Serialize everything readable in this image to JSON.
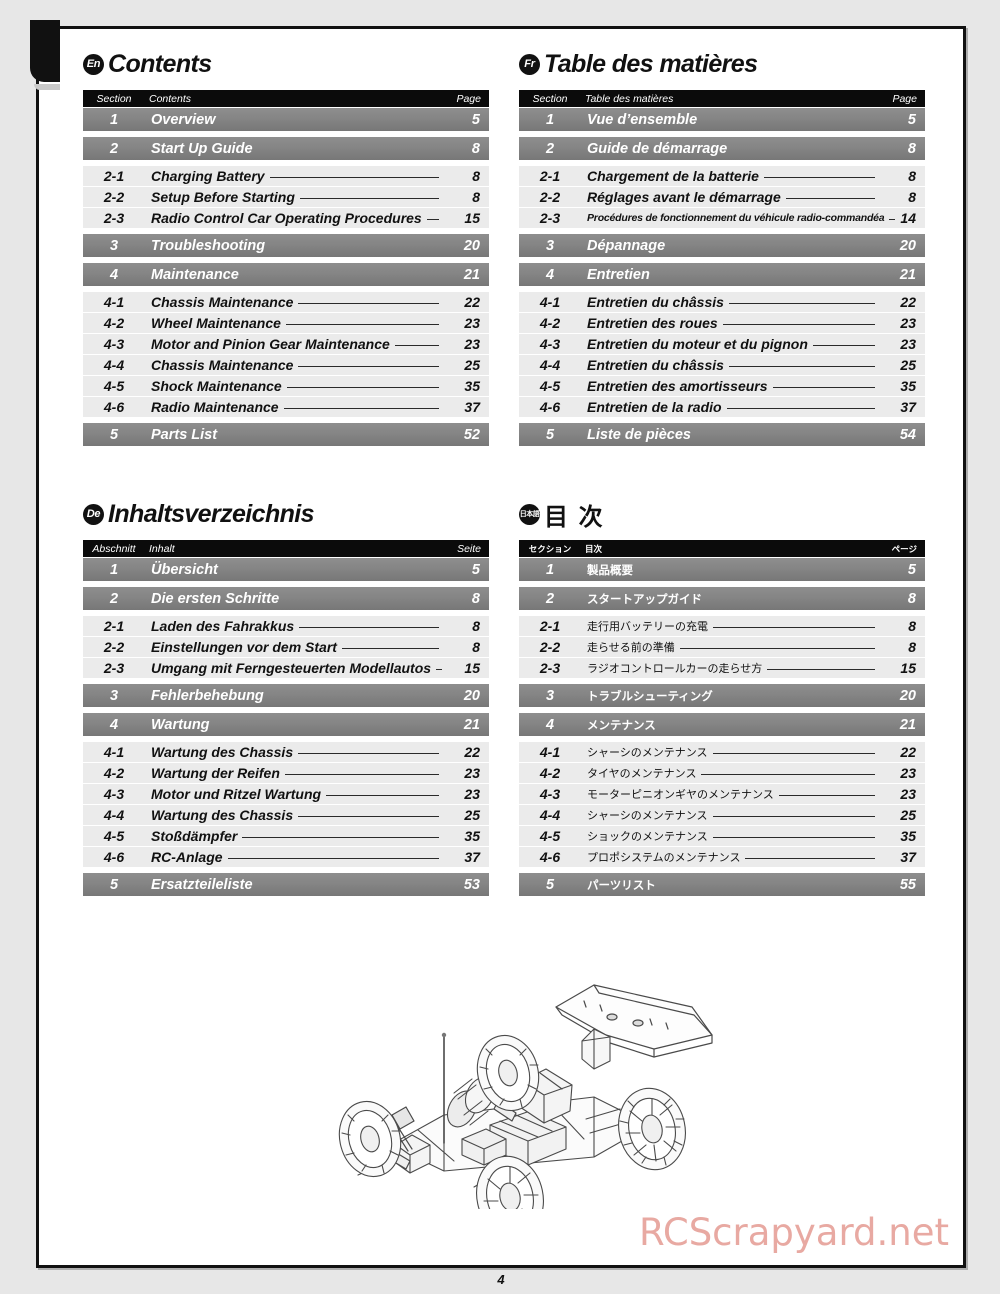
{
  "page": {
    "number": "4",
    "watermark": "RCScrapyard.net"
  },
  "toc_sections": [
    {
      "id": "en",
      "badge": "En",
      "title": "Contents",
      "headers": {
        "section": "Section",
        "name": "Contents",
        "page": "Page"
      },
      "rows": [
        {
          "type": "major",
          "sec": "1",
          "name": "Overview",
          "page": "5"
        },
        {
          "type": "major",
          "sec": "2",
          "name": "Start Up Guide",
          "page": "8"
        },
        {
          "type": "sub",
          "sec": "2-1",
          "name": "Charging Battery",
          "page": "8"
        },
        {
          "type": "sub",
          "sec": "2-2",
          "name": "Setup Before Starting",
          "page": "8"
        },
        {
          "type": "sub",
          "sec": "2-3",
          "name": "Radio Control Car Operating Procedures",
          "page": "15"
        },
        {
          "type": "major",
          "sec": "3",
          "name": "Troubleshooting",
          "page": "20"
        },
        {
          "type": "major",
          "sec": "4",
          "name": "Maintenance",
          "page": "21"
        },
        {
          "type": "sub",
          "sec": "4-1",
          "name": "Chassis Maintenance",
          "page": "22"
        },
        {
          "type": "sub",
          "sec": "4-2",
          "name": "Wheel Maintenance",
          "page": "23"
        },
        {
          "type": "sub",
          "sec": "4-3",
          "name": "Motor and Pinion Gear Maintenance",
          "page": "23"
        },
        {
          "type": "sub",
          "sec": "4-4",
          "name": "Chassis Maintenance",
          "page": "25"
        },
        {
          "type": "sub",
          "sec": "4-5",
          "name": "Shock Maintenance",
          "page": "35"
        },
        {
          "type": "sub",
          "sec": "4-6",
          "name": "Radio Maintenance",
          "page": "37"
        },
        {
          "type": "major",
          "sec": "5",
          "name": "Parts List",
          "page": "52"
        }
      ]
    },
    {
      "id": "fr",
      "badge": "Fr",
      "title": "Table des matières",
      "headers": {
        "section": "Section",
        "name": "Table des matières",
        "page": "Page"
      },
      "rows": [
        {
          "type": "major",
          "sec": "1",
          "name": "Vue d’ensemble",
          "page": "5"
        },
        {
          "type": "major",
          "sec": "2",
          "name": "Guide de démarrage",
          "page": "8"
        },
        {
          "type": "sub",
          "sec": "2-1",
          "name": "Chargement de la batterie",
          "page": "8"
        },
        {
          "type": "sub",
          "sec": "2-2",
          "name": "Réglages avant le démarrage",
          "page": "8"
        },
        {
          "type": "sub",
          "sec": "2-3",
          "name": "Procédures de fonctionnement du véhicule radio-commandéa",
          "page": "14",
          "small": true
        },
        {
          "type": "major",
          "sec": "3",
          "name": "Dépannage",
          "page": "20"
        },
        {
          "type": "major",
          "sec": "4",
          "name": "Entretien",
          "page": "21"
        },
        {
          "type": "sub",
          "sec": "4-1",
          "name": "Entretien du châssis",
          "page": "22"
        },
        {
          "type": "sub",
          "sec": "4-2",
          "name": "Entretien des roues",
          "page": "23"
        },
        {
          "type": "sub",
          "sec": "4-3",
          "name": "Entretien du moteur et du pignon",
          "page": "23"
        },
        {
          "type": "sub",
          "sec": "4-4",
          "name": "Entretien du châssis",
          "page": "25"
        },
        {
          "type": "sub",
          "sec": "4-5",
          "name": "Entretien des amortisseurs",
          "page": "35"
        },
        {
          "type": "sub",
          "sec": "4-6",
          "name": "Entretien de la radio",
          "page": "37"
        },
        {
          "type": "major",
          "sec": "5",
          "name": "Liste de pièces",
          "page": "54"
        }
      ]
    },
    {
      "id": "de",
      "badge": "De",
      "title": "Inhaltsverzeichnis",
      "headers": {
        "section": "Abschnitt",
        "name": "Inhalt",
        "page": "Seite"
      },
      "rows": [
        {
          "type": "major",
          "sec": "1",
          "name": "Übersicht",
          "page": "5"
        },
        {
          "type": "major",
          "sec": "2",
          "name": "Die ersten Schritte",
          "page": "8"
        },
        {
          "type": "sub",
          "sec": "2-1",
          "name": "Laden des Fahrakkus",
          "page": "8"
        },
        {
          "type": "sub",
          "sec": "2-2",
          "name": "Einstellungen vor dem Start",
          "page": "8"
        },
        {
          "type": "sub",
          "sec": "2-3",
          "name": "Umgang mit Ferngesteuerten Modellautos",
          "page": "15"
        },
        {
          "type": "major",
          "sec": "3",
          "name": "Fehlerbehebung",
          "page": "20"
        },
        {
          "type": "major",
          "sec": "4",
          "name": "Wartung",
          "page": "21"
        },
        {
          "type": "sub",
          "sec": "4-1",
          "name": "Wartung des Chassis",
          "page": "22"
        },
        {
          "type": "sub",
          "sec": "4-2",
          "name": "Wartung der Reifen",
          "page": "23"
        },
        {
          "type": "sub",
          "sec": "4-3",
          "name": "Motor und Ritzel Wartung",
          "page": "23"
        },
        {
          "type": "sub",
          "sec": "4-4",
          "name": "Wartung des Chassis",
          "page": "25"
        },
        {
          "type": "sub",
          "sec": "4-5",
          "name": "Stoßdämpfer",
          "page": "35"
        },
        {
          "type": "sub",
          "sec": "4-6",
          "name": "RC-Anlage",
          "page": "37"
        },
        {
          "type": "major",
          "sec": "5",
          "name": "Ersatzteileliste",
          "page": "53"
        }
      ]
    },
    {
      "id": "jp",
      "badge": "日本語",
      "title": "目 次",
      "headers": {
        "section": "セクション",
        "name": "目次",
        "page": "ページ"
      },
      "rows": [
        {
          "type": "major",
          "sec": "1",
          "name": "製品概要",
          "page": "5"
        },
        {
          "type": "major",
          "sec": "2",
          "name": "スタートアップガイド",
          "page": "8"
        },
        {
          "type": "sub",
          "sec": "2-1",
          "name": "走行用バッテリーの充電",
          "page": "8"
        },
        {
          "type": "sub",
          "sec": "2-2",
          "name": "走らせる前の準備",
          "page": "8"
        },
        {
          "type": "sub",
          "sec": "2-3",
          "name": "ラジオコントロールカーの走らせ方",
          "page": "15"
        },
        {
          "type": "major",
          "sec": "3",
          "name": "トラブルシューティング",
          "page": "20"
        },
        {
          "type": "major",
          "sec": "4",
          "name": "メンテナンス",
          "page": "21"
        },
        {
          "type": "sub",
          "sec": "4-1",
          "name": "シャーシのメンテナンス",
          "page": "22"
        },
        {
          "type": "sub",
          "sec": "4-2",
          "name": "タイヤのメンテナンス",
          "page": "23"
        },
        {
          "type": "sub",
          "sec": "4-3",
          "name": "モーターピニオンギヤのメンテナンス",
          "page": "23"
        },
        {
          "type": "sub",
          "sec": "4-4",
          "name": "シャーシのメンテナンス",
          "page": "25"
        },
        {
          "type": "sub",
          "sec": "4-5",
          "name": "ショックのメンテナンス",
          "page": "35"
        },
        {
          "type": "sub",
          "sec": "4-6",
          "name": "プロポシステムのメンテナンス",
          "page": "37"
        },
        {
          "type": "major",
          "sec": "5",
          "name": "パーツリスト",
          "page": "55"
        }
      ]
    }
  ],
  "illustration": {
    "name": "rc-buggy-chassis-line-art",
    "description": "Line art of an assembled radio control buggy chassis with rear wing"
  },
  "colors": {
    "header_row": "#0b0b0b",
    "major_row": "#858585",
    "sub_row": "#ebebeb",
    "watermark": "#e8a9a2",
    "page_bg": "#e7e7e7"
  }
}
